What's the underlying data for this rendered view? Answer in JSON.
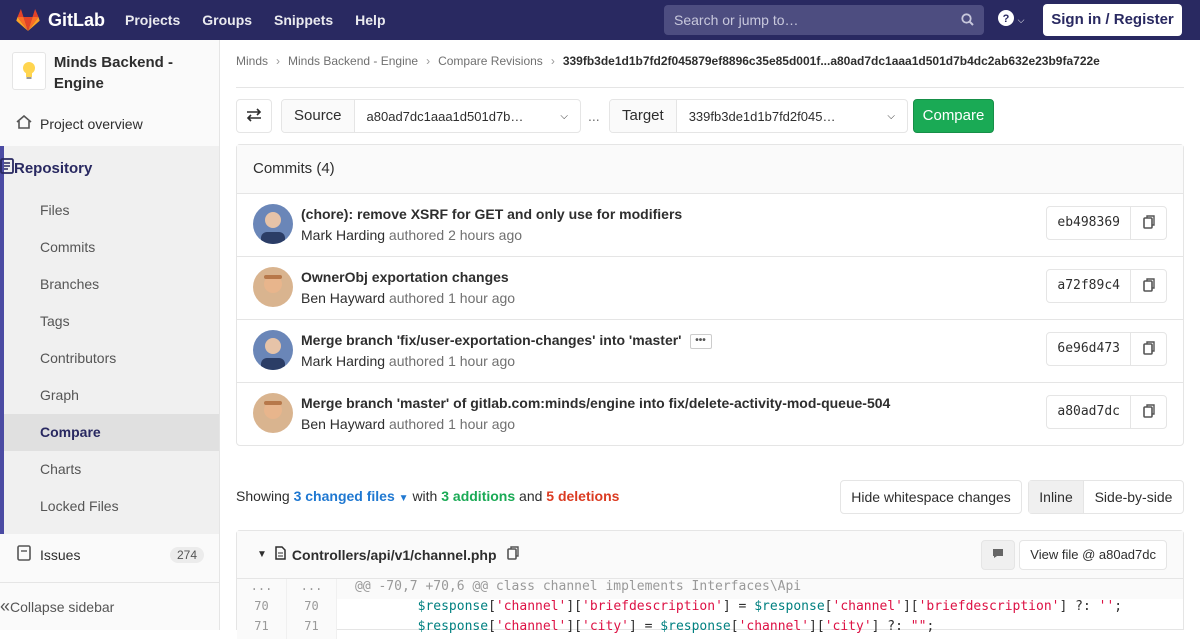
{
  "topbar": {
    "brand": "GitLab",
    "nav": [
      "Projects",
      "Groups",
      "Snippets",
      "Help"
    ],
    "search_placeholder": "Search or jump to…",
    "signin": "Sign in / Register"
  },
  "sidebar": {
    "project_name": "Minds Backend - Engine",
    "overview": "Project overview",
    "repository": "Repository",
    "items": [
      "Files",
      "Commits",
      "Branches",
      "Tags",
      "Contributors",
      "Graph",
      "Compare",
      "Charts",
      "Locked Files"
    ],
    "issues": "Issues",
    "issues_count": "274",
    "collapse": "Collapse sidebar"
  },
  "breadcrumb": [
    "Minds",
    "Minds Backend - Engine",
    "Compare Revisions",
    "339fb3de1d1b7fd2f045879ef8896c35e85d001f...a80ad7dc1aaa1d501d7b4dc2ab632e23b9fa722e"
  ],
  "compare": {
    "source_label": "Source",
    "source_value": "a80ad7dc1aaa1d501d7b…",
    "dots": "...",
    "target_label": "Target",
    "target_value": "339fb3de1d1b7fd2f045…",
    "button": "Compare"
  },
  "commits": {
    "header": "Commits (4)",
    "authored": "authored",
    "list": [
      {
        "title": "(chore): remove XSRF for GET and only use for modifiers",
        "author": "Mark Harding",
        "time": "2 hours ago",
        "sha": "eb498369"
      },
      {
        "title": "OwnerObj exportation changes",
        "author": "Ben Hayward",
        "time": "1 hour ago",
        "sha": "a72f89c4"
      },
      {
        "title": "Merge branch 'fix/user-exportation-changes' into 'master'",
        "author": "Mark Harding",
        "time": "1 hour ago",
        "sha": "6e96d473"
      },
      {
        "title": "Merge branch 'master' of gitlab.com:minds/engine into fix/delete-activity-mod-queue-504",
        "author": "Ben Hayward",
        "time": "1 hour ago",
        "sha": "a80ad7dc"
      }
    ]
  },
  "summary": {
    "showing": "Showing",
    "changed": "3 changed files",
    "with": "with",
    "additions": "3 additions",
    "and": "and",
    "deletions": "5 deletions"
  },
  "view_buttons": {
    "whitespace": "Hide whitespace changes",
    "inline": "Inline",
    "side": "Side-by-side"
  },
  "file": {
    "path": "Controllers/api/v1/channel.php",
    "view": "View file @ a80ad7dc",
    "lines": [
      {
        "old": "...",
        "new": "...",
        "code": "@@ -70,7 +70,6 @@ class channel implements Interfaces\\Api"
      },
      {
        "old": "70",
        "new": "70"
      },
      {
        "old": "71",
        "new": "71"
      }
    ]
  }
}
